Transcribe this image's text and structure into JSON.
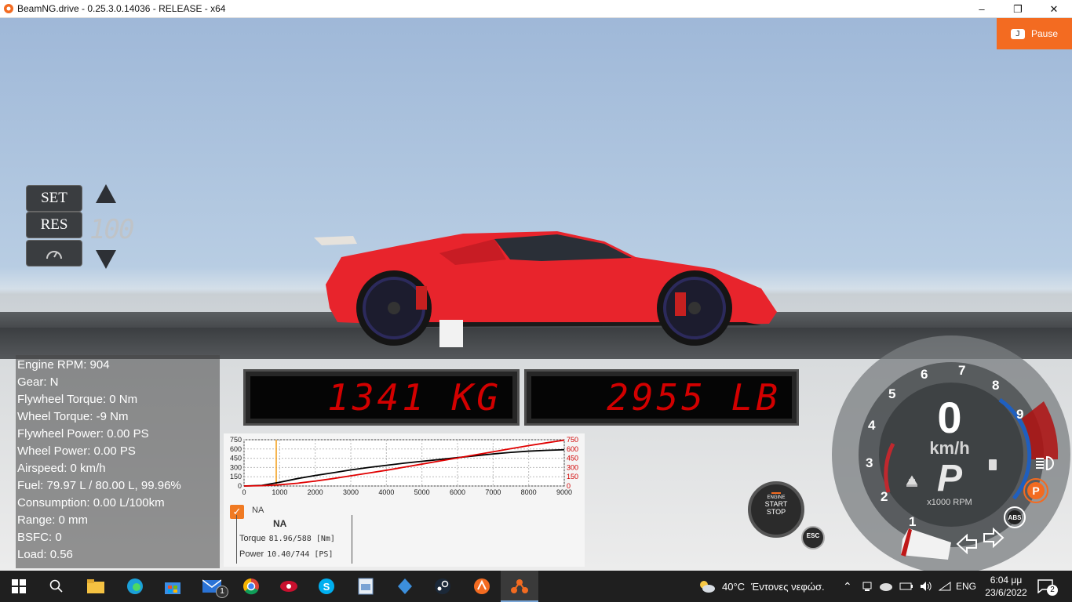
{
  "window": {
    "title": "BeamNG.drive - 0.25.3.0.14036 - RELEASE - x64",
    "minimize": "–",
    "restore": "❐",
    "close": "✕"
  },
  "pause": {
    "key": "J",
    "label": "Pause"
  },
  "cruise": {
    "set_label": "SET",
    "res_label": "RES",
    "speed": "100",
    "icons": [
      "up-arrow",
      "down-arrow",
      "speedometer-icon"
    ]
  },
  "displays": {
    "left": "1341 KG",
    "right": "2955 LB"
  },
  "stats": [
    "Engine RPM: 904",
    "Gear: N",
    "Flywheel Torque: 0 Nm",
    "Wheel Torque: -9 Nm",
    "Flywheel Power: 0.00 PS",
    "Wheel Power: 0.00 PS",
    "Airspeed: 0 km/h",
    "Fuel: 79.97 L / 80.00 L, 99.96%",
    "Consumption: 0.00 L/100km",
    "Range: 0 mm",
    "BSFC: 0",
    "Load: 0.56"
  ],
  "engine_panel": {
    "legend_name": "NA",
    "header": "NA",
    "torque_label": "Torque",
    "torque_value": "81.96/588 [Nm]",
    "power_label": "Power",
    "power_value": "10.40/744 [PS]"
  },
  "chart_data": {
    "type": "line",
    "x": [
      0,
      500,
      1000,
      1500,
      2000,
      2500,
      3000,
      3500,
      4000,
      4500,
      5000,
      5500,
      6000,
      6500,
      7000,
      7500,
      8000,
      8500,
      9000
    ],
    "series": [
      {
        "name": "Torque",
        "axis": "left",
        "color": "#000000",
        "values": [
          0,
          10,
          60,
          120,
          170,
          215,
          260,
          300,
          335,
          370,
          400,
          430,
          460,
          490,
          520,
          545,
          565,
          578,
          588
        ]
      },
      {
        "name": "Power",
        "axis": "right",
        "color": "#e00000",
        "values": [
          0,
          5,
          20,
          45,
          80,
          120,
          165,
          210,
          255,
          305,
          355,
          405,
          455,
          505,
          555,
          605,
          655,
          700,
          744
        ]
      }
    ],
    "xticks": [
      "0",
      "1000",
      "2000",
      "3000",
      "4000",
      "5000",
      "6000",
      "7000",
      "8000",
      "9000"
    ],
    "yticks_left": [
      "0",
      "150",
      "300",
      "450",
      "600",
      "750"
    ],
    "yticks_right": [
      "0",
      "150",
      "300",
      "450",
      "600",
      "750"
    ],
    "xlim": [
      0,
      9000
    ],
    "ylim": [
      0,
      750
    ],
    "marker_rpm": 904,
    "grid": true
  },
  "engine_button": {
    "line1": "ENGINE",
    "line2": "START",
    "line3": "STOP",
    "esc": "ESC"
  },
  "gauge": {
    "speed": "0",
    "unit": "km/h",
    "gear": "P",
    "rpm_label": "x1000 RPM",
    "ticks": [
      "1",
      "2",
      "3",
      "4",
      "5",
      "6",
      "7",
      "8",
      "9"
    ],
    "redline_color": "#b01010",
    "accent_blue": "#1f5fbf"
  },
  "taskbar": {
    "weather_temp": "40°C",
    "weather_text": "Έντονες νεφώσ.",
    "lang": "ENG",
    "time": "6:04 μμ",
    "date": "23/6/2022",
    "notif_count": "2",
    "mail_badge": "1"
  }
}
